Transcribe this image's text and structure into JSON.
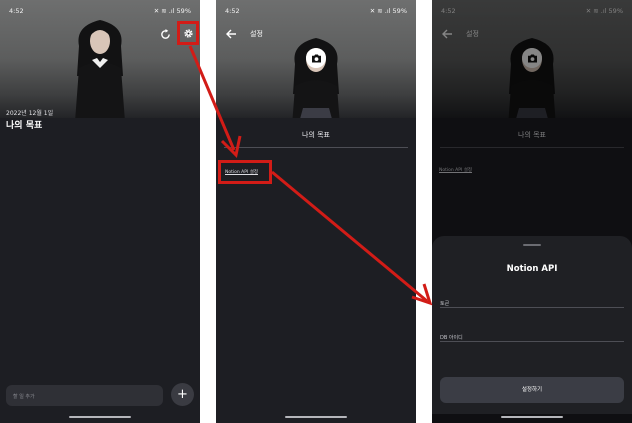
{
  "status": {
    "time": "4:52",
    "icons": "✕ ≋ .ıl 59%"
  },
  "screen1": {
    "date": "2022년 12월 1일",
    "title": "나의 목표",
    "input_placeholder": "할 일 추가",
    "fab_label": "+"
  },
  "screen2": {
    "appbar_title": "설정",
    "subtitle": "나의 목표",
    "notion_link": "Notion API 설정"
  },
  "screen3": {
    "appbar_title": "설정",
    "subtitle": "나의 목표",
    "notion_link": "Notion API 설정",
    "sheet": {
      "title": "Notion API",
      "token_placeholder": "토큰",
      "db_placeholder": "DB 아이디",
      "submit_label": "설정하기"
    }
  },
  "colors": {
    "annotation": "#d21c17",
    "background": "#1d1e23",
    "sheet": "#1f2024",
    "button": "#3b3d45"
  },
  "icons": [
    "refresh-icon",
    "gear-icon",
    "back-arrow-icon",
    "camera-icon",
    "plus-icon"
  ]
}
